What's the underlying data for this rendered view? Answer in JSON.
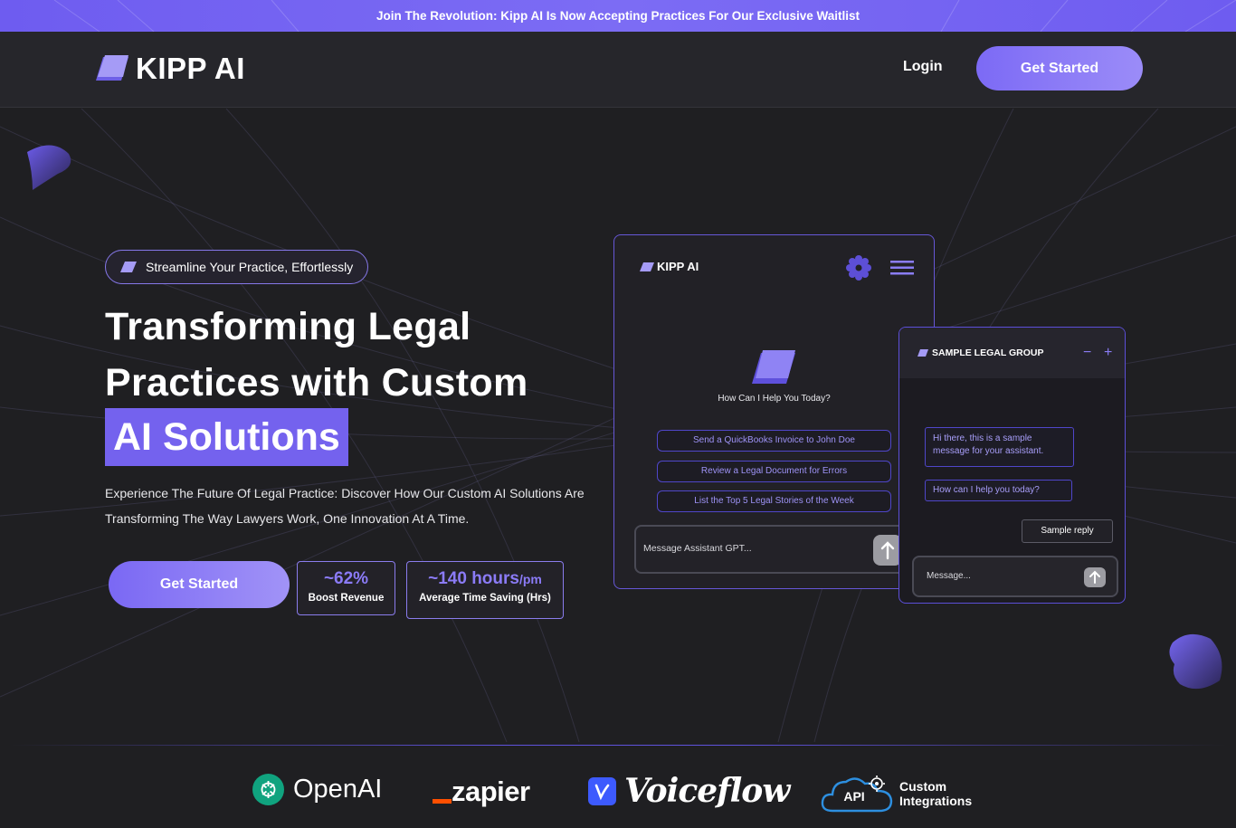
{
  "banner": {
    "text": "Join The Revolution: Kipp AI Is Now Accepting Practices For Our Exclusive Waitlist"
  },
  "header": {
    "logo_text": "KIPP AI",
    "login_label": "Login",
    "cta_label": "Get Started"
  },
  "hero": {
    "pill_text": "Streamline Your Practice, Effortlessly",
    "headline_line1": "Transforming Legal",
    "headline_line2": "Practices with Custom",
    "headline_highlight": "AI Solutions",
    "subtext": "Experience The Future Of Legal Practice: Discover How Our Custom AI Solutions Are Transforming The Way Lawyers Work, One Innovation At A Time.",
    "cta_label": "Get Started",
    "stats": [
      {
        "value": "~62%",
        "unit": "",
        "label": "Boost Revenue"
      },
      {
        "value": "~140 hours",
        "unit": "/pm",
        "label": "Average Time Saving (Hrs)"
      }
    ]
  },
  "assistant_mock": {
    "logo_text": "KIPP AI",
    "prompt": "How Can I Help You Today?",
    "suggestions": [
      "Send a QuickBooks Invoice to John Doe",
      "Review a Legal Document for Errors",
      "List the Top 5 Legal Stories of the Week"
    ],
    "input_placeholder": "Message Assistant GPT..."
  },
  "chat_widget": {
    "title": "SAMPLE LEGAL GROUP",
    "minimize_label": "−",
    "expand_label": "+",
    "message_1": "Hi there, this is a sample message for your assistant.",
    "message_2": "How can I help you today?",
    "reply": "Sample reply",
    "input_placeholder": "Message..."
  },
  "partners": {
    "openai": "OpenAI",
    "zapier": "zapier",
    "voiceflow": "Voiceflow",
    "api_badge": "API",
    "custom_line1": "Custom",
    "custom_line2": "Integrations"
  },
  "colors": {
    "accent": "#7462ee",
    "background": "#1f1f22",
    "header": "#26262b"
  }
}
